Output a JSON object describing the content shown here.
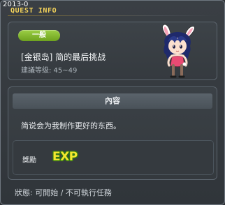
{
  "window": {
    "version": "2013-0",
    "title": "QUEST INFO"
  },
  "quest": {
    "category_badge": "一般",
    "name": "[金银岛] 简的最后挑战",
    "level": "建議等级: 45~49",
    "npc_icon": "bunny-girl-npc-portrait"
  },
  "content": {
    "section_title": "內容",
    "description": "简说会为我制作更好的东西。"
  },
  "reward": {
    "label": "獎勵",
    "exp_label": "EXP",
    "exp_icon": "exp-icon"
  },
  "status": {
    "text": "狀態: 可開始 / 不可執行任務"
  },
  "colors": {
    "title": "#f4d35a",
    "badge_green": "#8cc63f",
    "exp_yellow": "#f5e62f",
    "window_bg": "#3a3f44"
  }
}
